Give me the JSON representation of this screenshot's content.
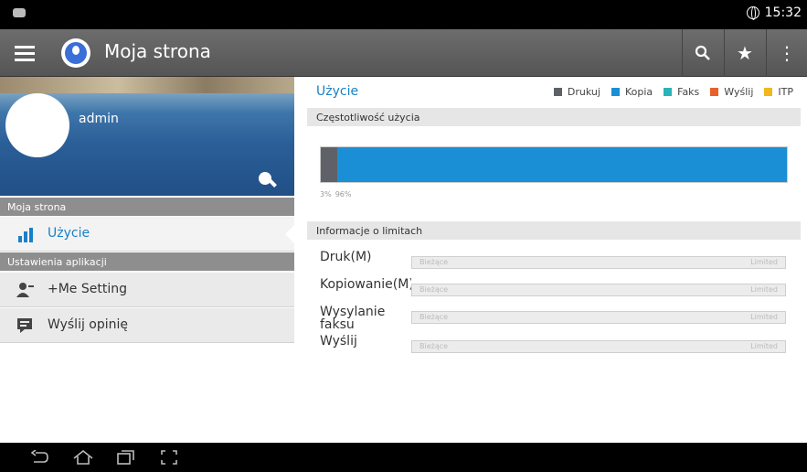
{
  "status_bar": {
    "time": "15:32"
  },
  "action_bar": {
    "title": "Moja strona"
  },
  "sidebar": {
    "username": "admin",
    "section_mypage": "Moja strona",
    "usage_item": "Użycie",
    "section_appsettings": "Ustawienia aplikacji",
    "me_setting_item": "+Me Setting",
    "feedback_item": "Wyślij opinię"
  },
  "main": {
    "usage_title": "Użycie",
    "legend": [
      {
        "label": "Drukuj",
        "color": "#5e6268"
      },
      {
        "label": "Kopia",
        "color": "#1a8fd6"
      },
      {
        "label": "Faks",
        "color": "#2bb3b8"
      },
      {
        "label": "Wyślij",
        "color": "#e8602c"
      },
      {
        "label": "ITP",
        "color": "#f0b81e"
      }
    ],
    "frequency_header": "Częstotliwość użycia",
    "usage_percent_print": "3%",
    "usage_percent_copy": "96%",
    "limits_header": "Informacje o limitach",
    "limits": [
      {
        "label": "Druk(M)",
        "current": "Bieżące",
        "status": "Limited"
      },
      {
        "label": "Kopiowanie(M)",
        "current": "Bieżące",
        "status": "Limited"
      },
      {
        "label": "Wysylanie faksu",
        "current": "Bieżące",
        "status": "Limited"
      },
      {
        "label": "Wyślij",
        "current": "Bieżące",
        "status": "Limited"
      }
    ]
  }
}
